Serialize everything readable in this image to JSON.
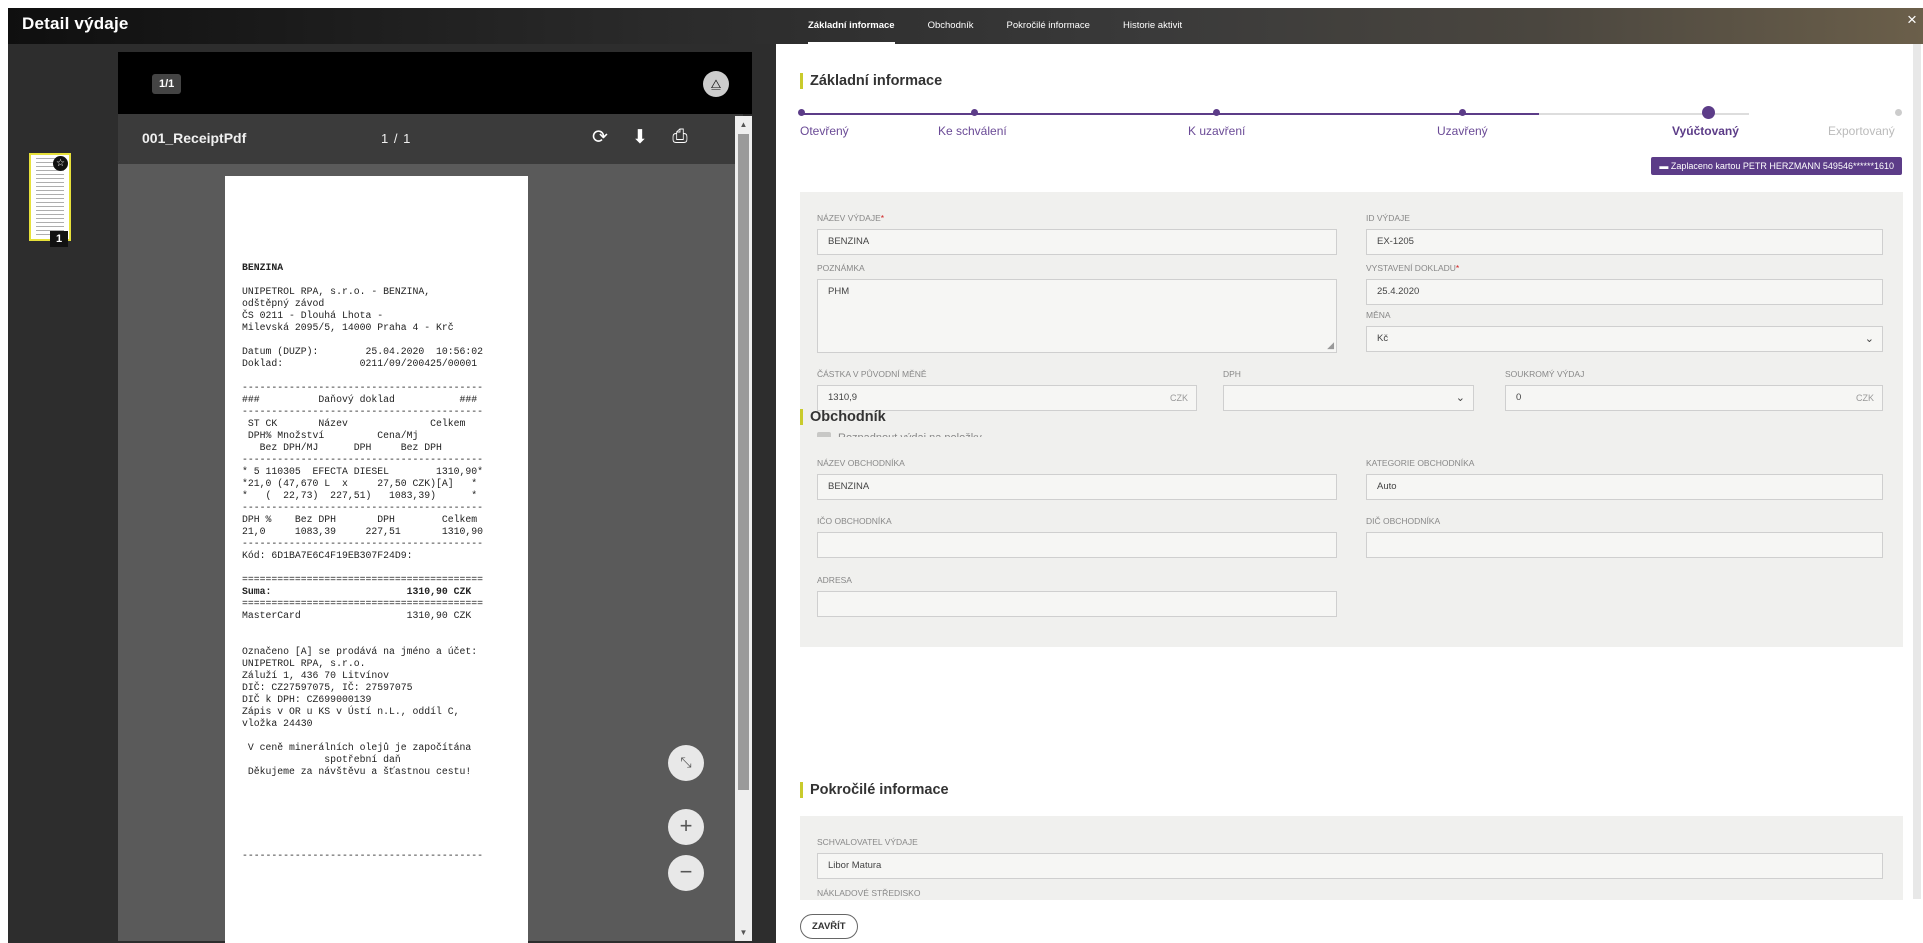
{
  "app": {
    "title": "Detail výdaje",
    "close_label": "×"
  },
  "tabs": [
    {
      "label": "Základní informace",
      "active": true
    },
    {
      "label": "Obchodník",
      "active": false
    },
    {
      "label": "Pokročilé informace",
      "active": false
    },
    {
      "label": "Historie aktivit",
      "active": false
    }
  ],
  "viewer": {
    "page_chip": "1/1",
    "thumbnail_number": "1",
    "file_name": "001_ReceiptPdf",
    "page_indicator": "1 / 1",
    "receipt_lines": [
      "BENZINA",
      "",
      "UNIPETROL RPA, s.r.o. - BENZINA,",
      "odštěpný závod",
      "ČS 0211 - Dlouhá Lhota -",
      "Milevská 2095/5, 14000 Praha 4 - Krč",
      "",
      "Datum (DUZP):        25.04.2020  10:56:02",
      "Doklad:             0211/09/200425/00001",
      "",
      "-----------------------------------------",
      "###          Daňový doklad           ###",
      "-----------------------------------------",
      " ST CK       Název              Celkem",
      " DPH% Množství         Cena/Mj",
      "   Bez DPH/MJ      DPH     Bez DPH",
      "-----------------------------------------",
      "* 5 110305  EFECTA DIESEL        1310,90*",
      "*21,0 (47,670 L  x     27,50 CZK)[A]   *",
      "*   (  22,73)  227,51)   1083,39)      *",
      "-----------------------------------------",
      "DPH %    Bez DPH       DPH        Celkem",
      "21,0     1083,39     227,51       1310,90",
      "-----------------------------------------",
      "Kód: 6D1BA7E6C4F19EB307F24D9:",
      "",
      "=========================================",
      "Suma:                       1310,90 CZK",
      "=========================================",
      "MasterCard                  1310,90 CZK",
      "",
      "",
      "Označeno [A] se prodává na jméno a účet:",
      "UNIPETROL RPA, s.r.o.",
      "Záluží 1, 436 70 Litvínov",
      "DIČ: CZ27597075, IČ: 27597075",
      "DIČ k DPH: CZ699000139",
      "Zápis v OR u KS v Ústí n.L., oddíl C,",
      "vložka 24430",
      "",
      " V ceně minerálních olejů je započítána",
      "              spotřební daň",
      " Děkujeme za návštěvu a šťastnou cestu!",
      "",
      "",
      "",
      "",
      "",
      "",
      "-----------------------------------------"
    ]
  },
  "basic": {
    "section_title": "Základní informace",
    "steps": [
      {
        "label": "Otevřený"
      },
      {
        "label": "Ke schválení"
      },
      {
        "label": "K uzavření"
      },
      {
        "label": "Uzavřený"
      },
      {
        "label": "Vyúčtovaný"
      },
      {
        "label": "Exportovaný"
      }
    ],
    "paid_chip": "Zaplaceno kartou PETR HERZMANN 549546******1610",
    "fields": {
      "name_label": "NÁZEV VÝDAJE",
      "name_value": "BENZINA",
      "id_label": "ID VÝDAJE",
      "id_value": "EX-1205",
      "note_label": "POZNÁMKA",
      "note_value": "PHM",
      "issued_label": "VYSTAVENÍ DOKLADU",
      "issued_value": "25.4.2020",
      "currency_label": "MĚNA",
      "currency_value": "Kč",
      "amount_label": "ČÁSTKA V PŮVODNÍ MĚNĚ",
      "amount_value": "1310,9",
      "amount_suffix": "CZK",
      "vat_label": "DPH",
      "vat_value": "",
      "private_label": "SOUKROMÝ VÝDAJ",
      "private_value": "0",
      "private_suffix": "CZK",
      "split_label": "Rozpadnout výdaj na položky",
      "required_mark": "*"
    }
  },
  "merchant": {
    "section_title": "Obchodník",
    "name_label": "NÁZEV OBCHODNÍKA",
    "name_value": "BENZINA",
    "category_label": "KATEGORIE OBCHODNÍKA",
    "category_value": "Auto",
    "ico_label": "IČO OBCHODNÍKA",
    "ico_value": "",
    "dic_label": "DIČ OBCHODNÍKA",
    "dic_value": "",
    "address_label": "ADRESA",
    "address_value": ""
  },
  "advanced": {
    "section_title": "Pokročilé informace",
    "approver_label": "SCHVALOVATEL VÝDAJE",
    "approver_value": "Libor Matura",
    "cost_center_label": "NÁKLADOVÉ STŘEDISKO"
  },
  "footer": {
    "close_button": "ZAVŘÍT"
  }
}
